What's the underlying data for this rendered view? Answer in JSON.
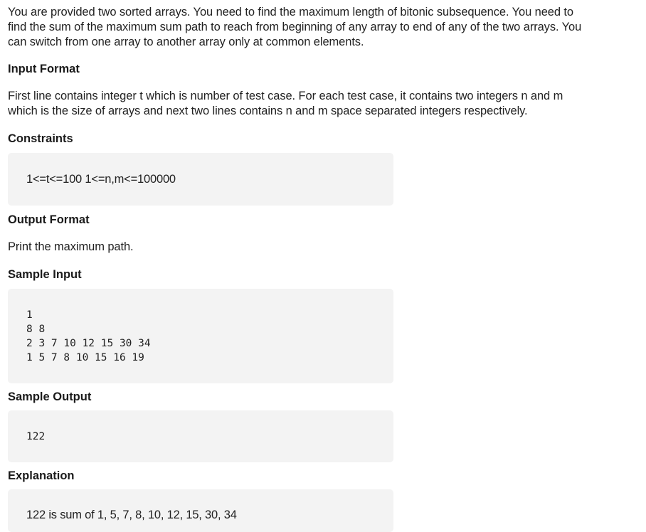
{
  "problem": {
    "intro_lines": [
      "You are provided two sorted arrays. You need to find the maximum length of bitonic subsequence. You need to",
      "find the sum of the maximum sum path to reach from beginning of any array to end of any of the two arrays. You",
      "can switch from one array to another array only at common elements."
    ],
    "input_format": {
      "heading": "Input Format",
      "lines": [
        "First line contains integer t which is number of test case. For each test case, it contains two integers n and m",
        "which is the size of arrays and next two lines contains n and m space separated integers respectively."
      ]
    },
    "constraints": {
      "heading": "Constraints",
      "text": "1<=t<=100 1<=n,m<=100000"
    },
    "output_format": {
      "heading": "Output Format",
      "text": "Print the maximum path."
    },
    "sample_input": {
      "heading": "Sample Input",
      "lines": [
        "1",
        "8 8",
        "2 3 7 10 12 15 30 34",
        "1 5 7 8 10 15 16 19"
      ]
    },
    "sample_output": {
      "heading": "Sample Output",
      "text": "122"
    },
    "explanation": {
      "heading": "Explanation",
      "text": "122 is sum of 1, 5, 7, 8, 10, 12, 15, 30, 34"
    }
  }
}
